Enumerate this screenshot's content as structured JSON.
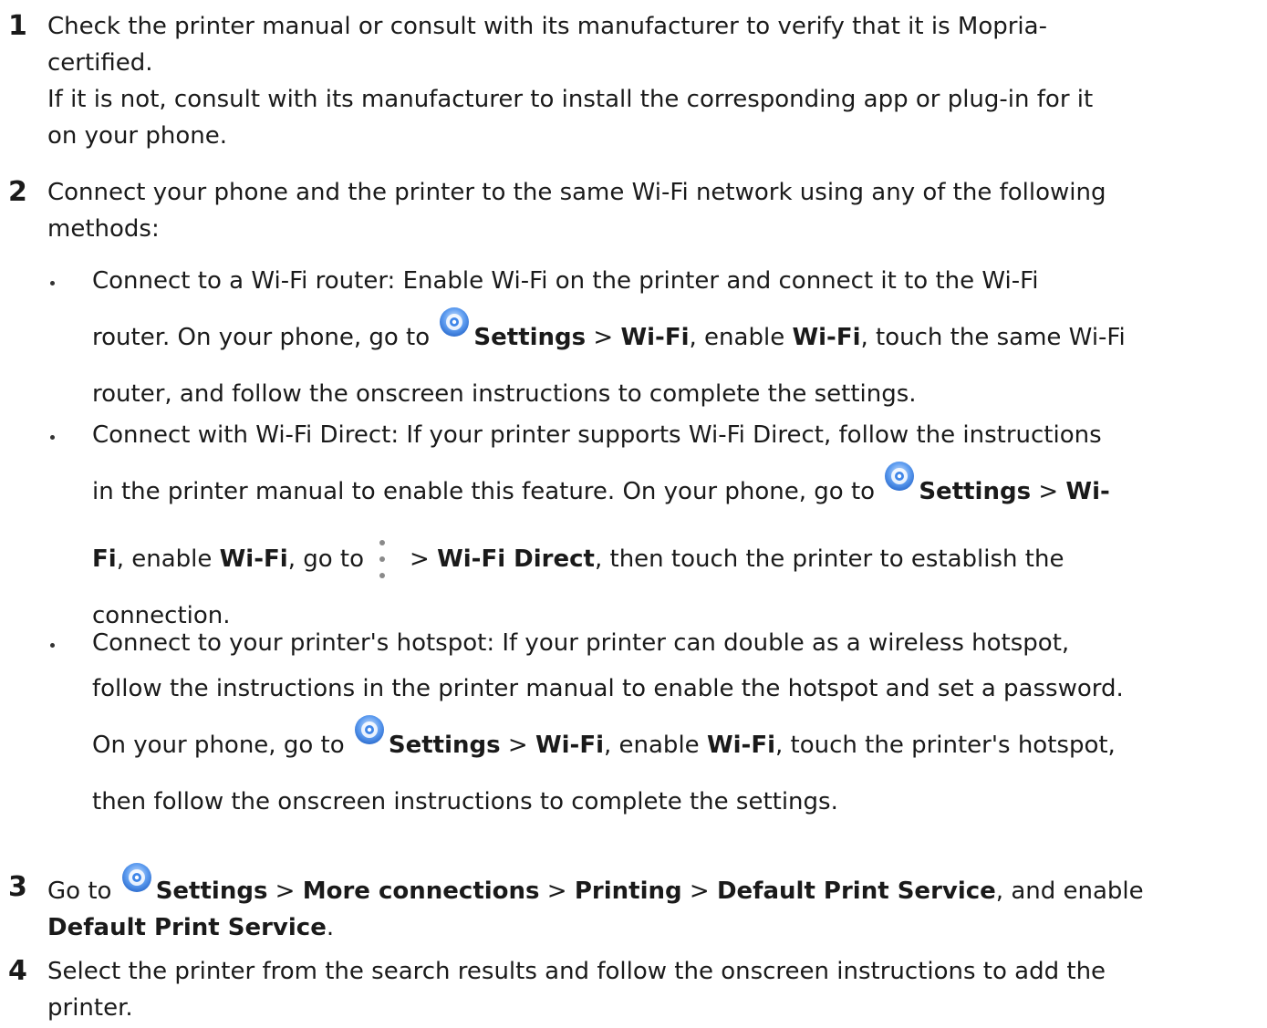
{
  "steps": [
    {
      "number": "1",
      "lines": [
        "Check the printer manual or consult with its manufacturer to verify that it is Mopria-",
        "certified.",
        "If it is not, consult with its manufacturer to install the corresponding app or plug-in for it",
        "on your phone."
      ]
    },
    {
      "number": "2",
      "lines": [
        "Connect your phone and the printer to the same Wi-Fi network using any of the following",
        "methods:"
      ],
      "bullets": [
        {
          "line1": "Connect to a Wi-Fi router: Enable Wi-Fi on the printer and connect it to the Wi-Fi",
          "line2_pre": "router. On your phone, go to",
          "line2_settings": "Settings",
          "line2_sep1": " > ",
          "line2_wifi1": "Wi-Fi",
          "line2_mid": ", enable ",
          "line2_wifi2": "Wi-Fi",
          "line2_post": ", touch the same Wi-Fi",
          "line3": "router, and follow the onscreen instructions to complete the settings."
        },
        {
          "line1": "Connect with Wi-Fi Direct: If your printer supports Wi-Fi Direct, follow the instructions",
          "line2_pre": "in the printer manual to enable this feature. On your phone, go to",
          "line2_settings": "Settings",
          "line2_sep1": " > ",
          "line2_wifi_part": "Wi-",
          "line3_wifi_part": "Fi",
          "line3_enable": ", enable ",
          "line3_wifi": "Wi-Fi",
          "line3_goto": ", go to",
          "line3_sep": "> ",
          "line3_direct": "Wi-Fi Direct",
          "line3_post": ", then touch the printer to establish the",
          "line4": "connection."
        },
        {
          "line1": "Connect to your printer's hotspot: If your printer can double as a wireless hotspot,",
          "line2": "follow the instructions in the printer manual to enable the hotspot and set a password.",
          "line3_pre": "On your phone, go to",
          "line3_settings": "Settings",
          "line3_sep1": " > ",
          "line3_wifi1": "Wi-Fi",
          "line3_mid": ", enable ",
          "line3_wifi2": "Wi-Fi",
          "line3_post": ", touch the printer's hotspot,",
          "line4": "then follow the onscreen instructions to complete the settings."
        }
      ]
    },
    {
      "number": "3",
      "line1_pre": "Go to",
      "line1_settings": "Settings",
      "line1_sep1": " > ",
      "line1_more": "More connections",
      "line1_sep2": " > ",
      "line1_printing": "Printing",
      "line1_sep3": " > ",
      "line1_default": "Default Print Service",
      "line1_post": ", and enable",
      "line2_default": "Default Print Service",
      "line2_post": "."
    },
    {
      "number": "4",
      "lines": [
        "Select the printer from the search results and follow the onscreen instructions to add the",
        "printer."
      ]
    }
  ],
  "icons": {
    "settings": "settings-app-icon",
    "more": "more-vertical-icon"
  },
  "colors": {
    "text": "#1a1a1a",
    "settings_icon_blue": "#3f86e8",
    "more_icon_gray": "#8a8a8a"
  }
}
